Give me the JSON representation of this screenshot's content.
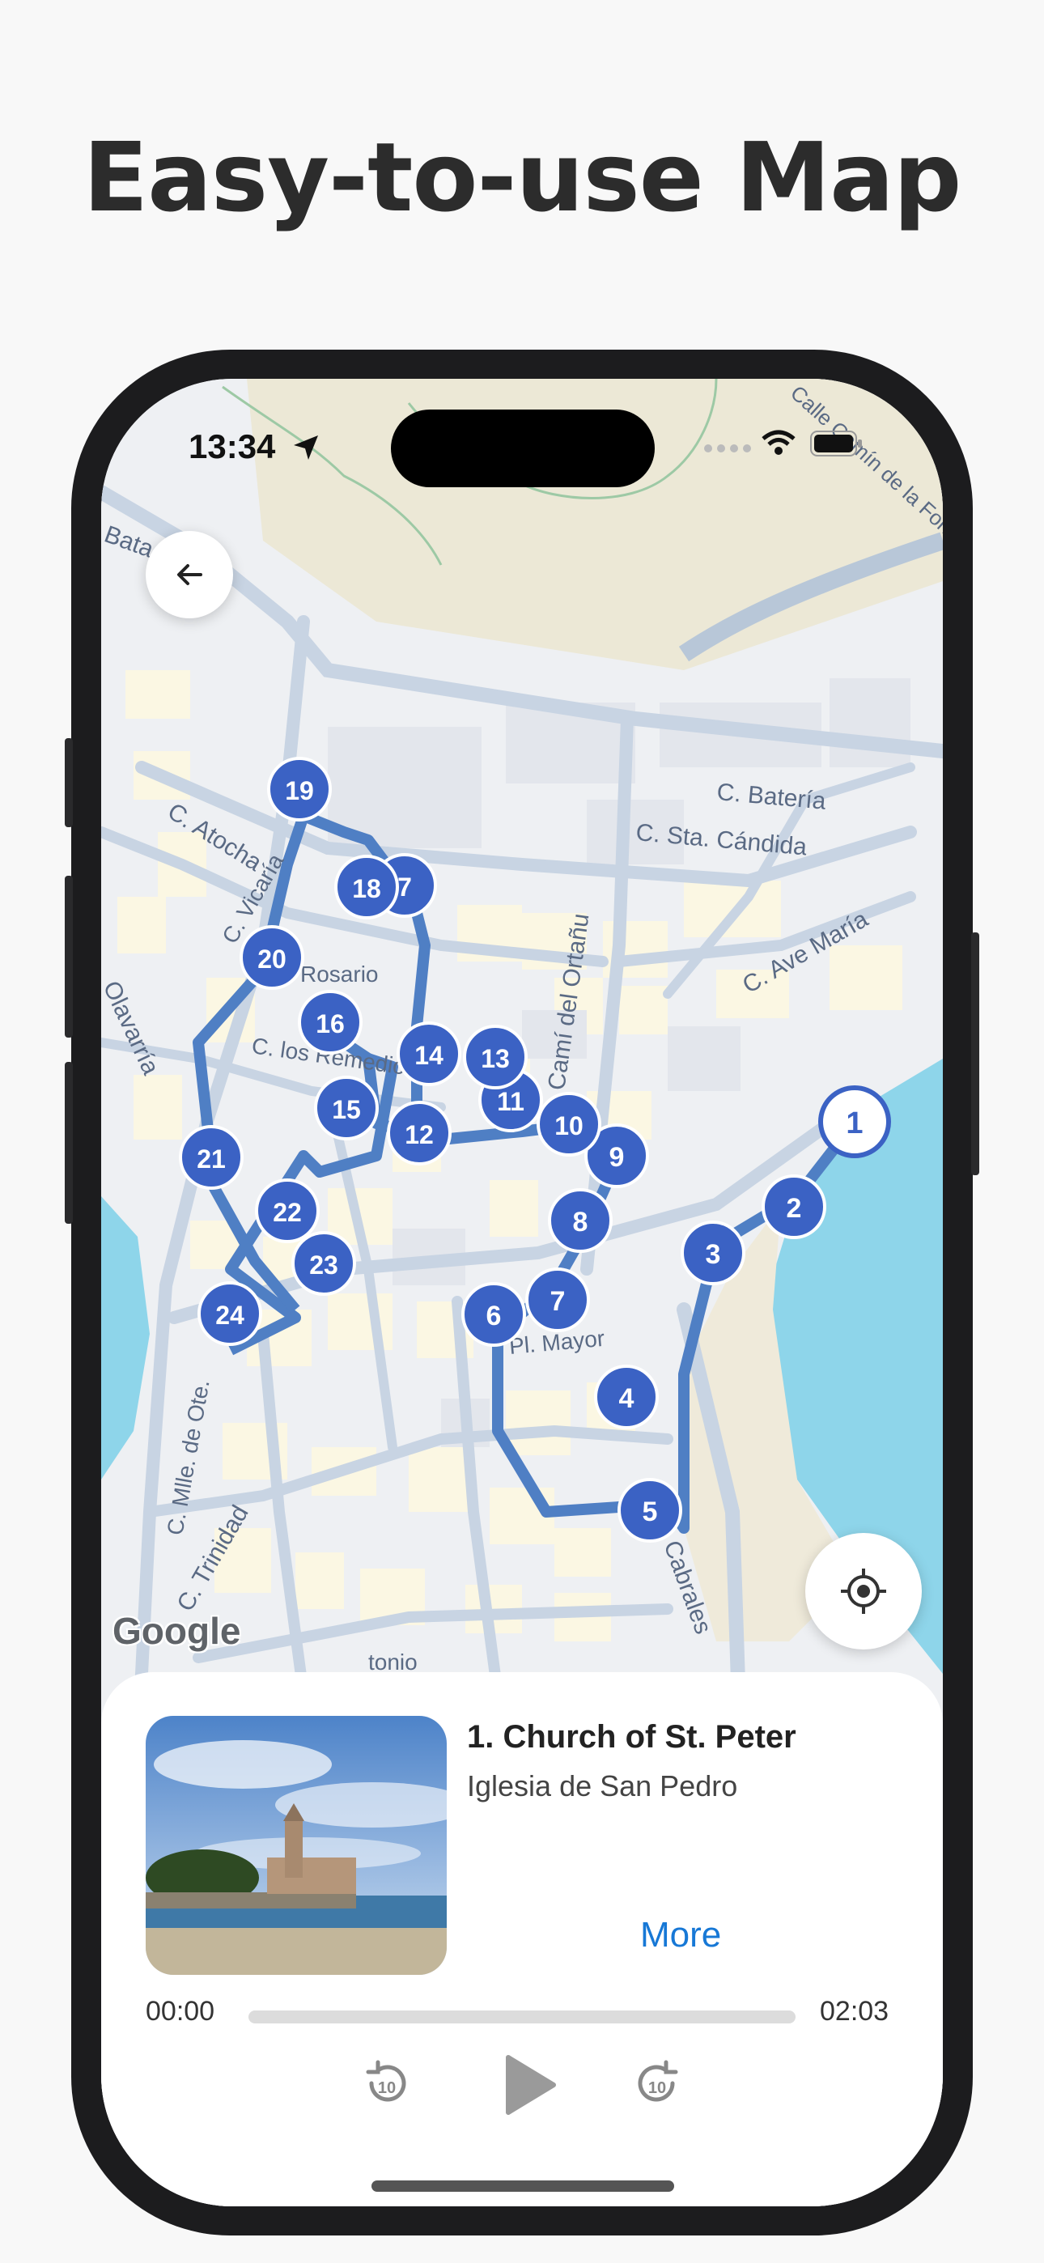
{
  "headline": "Easy-to-use Map",
  "status_bar": {
    "time": "13:34"
  },
  "map": {
    "attribution": "Google",
    "street_labels": [
      "Bata",
      "Calle Camín de la Fontica",
      "C. Batería",
      "C. Sta. Cándida",
      "C. Ave María",
      "C. Atocha",
      "C. Vicaría",
      "Rosario",
      "C. los Remedios",
      "Camí del Ortañu",
      "Olavarría",
      "Pl. Mayor",
      "C. Mlle. de Ote.",
      "C. Trinidad",
      "Cabrales",
      "tonio"
    ],
    "markers": [
      "1",
      "2",
      "3",
      "4",
      "5",
      "6",
      "7",
      "8",
      "9",
      "10",
      "11",
      "12",
      "13",
      "14",
      "15",
      "16",
      "7",
      "18",
      "19",
      "20",
      "21",
      "22",
      "23",
      "24"
    ],
    "selected_marker": "1",
    "accent_color": "#3b62c4"
  },
  "player": {
    "title": "1. Church of St. Peter",
    "subtitle": "Iglesia de San Pedro",
    "more_label": "More",
    "elapsed": "00:00",
    "duration": "02:03",
    "progress": 0,
    "rewind_seconds": "10",
    "forward_seconds": "10"
  }
}
